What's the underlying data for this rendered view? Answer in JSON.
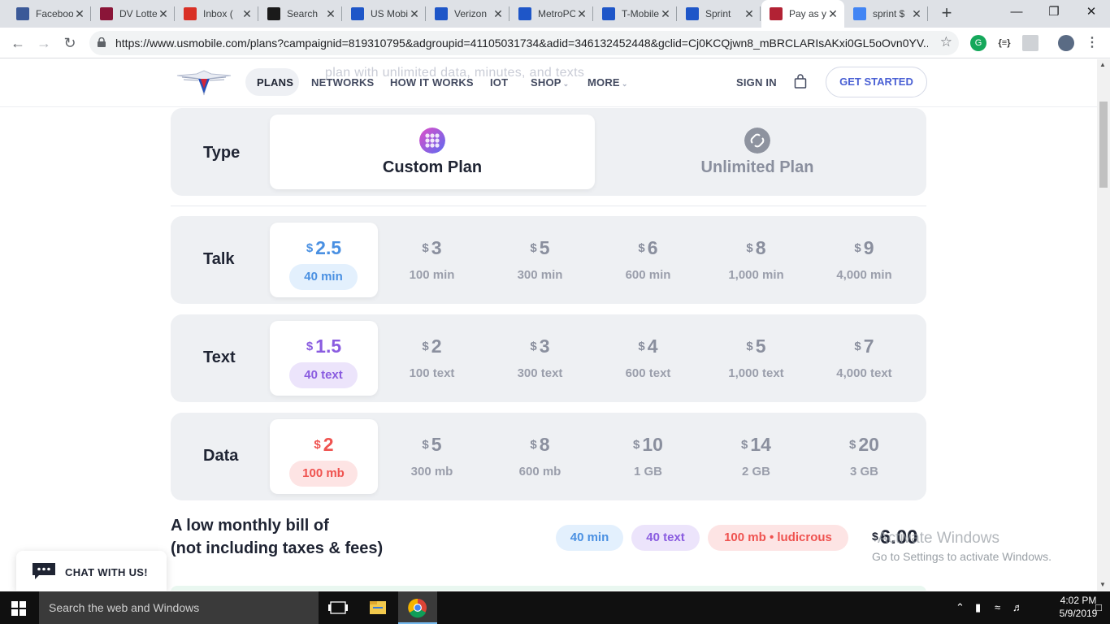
{
  "browser": {
    "tabs": [
      {
        "title": "Facebook",
        "icon": "facebook-icon",
        "color": "#3b5998"
      },
      {
        "title": "DV Lottery",
        "icon": "dv-lottery-icon",
        "color": "#8a1538"
      },
      {
        "title": "Inbox (",
        "icon": "gmail-icon",
        "color": "#d93025"
      },
      {
        "title": "Search",
        "icon": "w-icon",
        "color": "#1a1a1a"
      },
      {
        "title": "US Mobile",
        "icon": "usmobile-icon",
        "color": "#1e56c8"
      },
      {
        "title": "Verizon",
        "icon": "usmobile-icon",
        "color": "#1e56c8"
      },
      {
        "title": "MetroPCS",
        "icon": "usmobile-icon",
        "color": "#1e56c8"
      },
      {
        "title": "T-Mobile",
        "icon": "usmobile-icon",
        "color": "#1e56c8"
      },
      {
        "title": "Sprint",
        "icon": "usmobile-icon",
        "color": "#1e56c8"
      },
      {
        "title": "Pay as you",
        "icon": "us-flag-icon",
        "color": "#b22234"
      },
      {
        "title": "sprint $",
        "icon": "google-icon",
        "color": "#4285f4"
      }
    ],
    "active_tab_index": 9,
    "url": "https://www.usmobile.com/plans?campaignid=819310795&adgroupid=41105031734&adid=346132452448&gclid=Cj0KCQjwn8_mBRCLARIsAKxi0GL5oOvn0YV..."
  },
  "site": {
    "ghost_text": "plan with unlimited data, minutes, and texts",
    "nav": [
      "PLANS",
      "NETWORKS",
      "HOW IT WORKS",
      "IOT",
      "SHOP",
      "MORE"
    ],
    "sign_in": "SIGN IN",
    "get_started": "GET STARTED"
  },
  "plan_type": {
    "label": "Type",
    "options": [
      {
        "name": "Custom Plan",
        "selected": true
      },
      {
        "name": "Unlimited Plan",
        "selected": false
      }
    ]
  },
  "talk": {
    "label": "Talk",
    "options": [
      {
        "price": "2.5",
        "amount": "40 min"
      },
      {
        "price": "3",
        "amount": "100 min"
      },
      {
        "price": "5",
        "amount": "300 min"
      },
      {
        "price": "6",
        "amount": "600 min"
      },
      {
        "price": "8",
        "amount": "1,000 min"
      },
      {
        "price": "9",
        "amount": "4,000 min"
      }
    ],
    "accent": "#4a90e2",
    "chip_bg": "#e3f0fd"
  },
  "text": {
    "label": "Text",
    "options": [
      {
        "price": "1.5",
        "amount": "40 text"
      },
      {
        "price": "2",
        "amount": "100 text"
      },
      {
        "price": "3",
        "amount": "300 text"
      },
      {
        "price": "4",
        "amount": "600 text"
      },
      {
        "price": "5",
        "amount": "1,000 text"
      },
      {
        "price": "7",
        "amount": "4,000 text"
      }
    ],
    "accent": "#8a5ce0",
    "chip_bg": "#ece4fb"
  },
  "data": {
    "label": "Data",
    "options": [
      {
        "price": "2",
        "amount": "100 mb"
      },
      {
        "price": "5",
        "amount": "300 mb"
      },
      {
        "price": "8",
        "amount": "600 mb"
      },
      {
        "price": "10",
        "amount": "1 GB"
      },
      {
        "price": "14",
        "amount": "2 GB"
      },
      {
        "price": "20",
        "amount": "3 GB"
      }
    ],
    "accent": "#ef5350",
    "chip_bg": "#fde4e4"
  },
  "currency": "$",
  "summary": {
    "title_line1": "A low monthly bill of",
    "title_line2": "(not including taxes & fees)",
    "chips": [
      "40 min",
      "40 text",
      "100 mb • ludicrous"
    ],
    "total": "6.00"
  },
  "watermark": {
    "line1": "Activate Windows",
    "line2": "Go to Settings to activate Windows."
  },
  "chat": {
    "label": "CHAT WITH US!"
  },
  "taskbar": {
    "search_placeholder": "Search the web and Windows",
    "time": "4:02 PM",
    "date": "5/9/2019"
  }
}
